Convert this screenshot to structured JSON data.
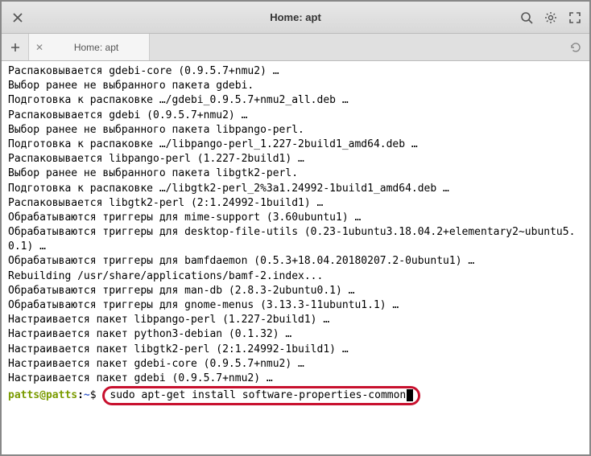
{
  "window": {
    "title": "Home: apt"
  },
  "tab": {
    "title": "Home: apt"
  },
  "terminal": {
    "lines": [
      "Распаковывается gdebi-core (0.9.5.7+nmu2) …",
      "Выбор ранее не выбранного пакета gdebi.",
      "Подготовка к распаковке …/gdebi_0.9.5.7+nmu2_all.deb …",
      "Распаковывается gdebi (0.9.5.7+nmu2) …",
      "Выбор ранее не выбранного пакета libpango-perl.",
      "Подготовка к распаковке …/libpango-perl_1.227-2build1_amd64.deb …",
      "Распаковывается libpango-perl (1.227-2build1) …",
      "Выбор ранее не выбранного пакета libgtk2-perl.",
      "Подготовка к распаковке …/libgtk2-perl_2%3a1.24992-1build1_amd64.deb …",
      "Распаковывается libgtk2-perl (2:1.24992-1build1) …",
      "Обрабатываются триггеры для mime-support (3.60ubuntu1) …",
      "Обрабатываются триггеры для desktop-file-utils (0.23-1ubuntu3.18.04.2+elementary2~ubuntu5.0.1) …",
      "Обрабатываются триггеры для bamfdaemon (0.5.3+18.04.20180207.2-0ubuntu1) …",
      "Rebuilding /usr/share/applications/bamf-2.index...",
      "Обрабатываются триггеры для man-db (2.8.3-2ubuntu0.1) …",
      "Обрабатываются триггеры для gnome-menus (3.13.3-11ubuntu1.1) …",
      "Настраивается пакет libpango-perl (1.227-2build1) …",
      "Настраивается пакет python3-debian (0.1.32) …",
      "Настраивается пакет libgtk2-perl (2:1.24992-1build1) …",
      "Настраивается пакет gdebi-core (0.9.5.7+nmu2) …",
      "Настраивается пакет gdebi (0.9.5.7+nmu2) …"
    ],
    "prompt_user": "patts@patts",
    "prompt_path": "~",
    "command": "sudo apt-get install software-properties-common"
  }
}
